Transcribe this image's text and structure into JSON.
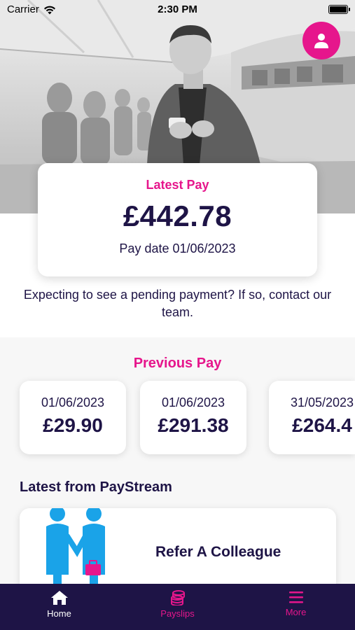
{
  "status_bar": {
    "carrier": "Carrier",
    "time": "2:30 PM"
  },
  "colors": {
    "accent": "#e6168c",
    "navy": "#1e1446",
    "background": "#ffffff",
    "section_bg": "#f7f7f7"
  },
  "profile": {
    "icon": "person-icon"
  },
  "latest_pay": {
    "title": "Latest Pay",
    "amount": "£442.78",
    "pay_date": "Pay date 01/06/2023"
  },
  "pending_message": "Expecting to see a pending payment? If so, contact our team.",
  "previous_pay": {
    "title": "Previous Pay",
    "items": [
      {
        "date": "01/06/2023",
        "amount": "£29.90"
      },
      {
        "date": "01/06/2023",
        "amount": "£291.38"
      },
      {
        "date": "31/05/2023",
        "amount": "£264.4"
      }
    ]
  },
  "news": {
    "title": "Latest from PayStream",
    "items": [
      {
        "label": "Refer A Colleague"
      }
    ]
  },
  "tab_bar": {
    "tabs": [
      {
        "label": "Home",
        "icon": "home-icon",
        "active": true
      },
      {
        "label": "Payslips",
        "icon": "coins-icon",
        "active": false
      },
      {
        "label": "More",
        "icon": "menu-icon",
        "active": false
      }
    ]
  }
}
